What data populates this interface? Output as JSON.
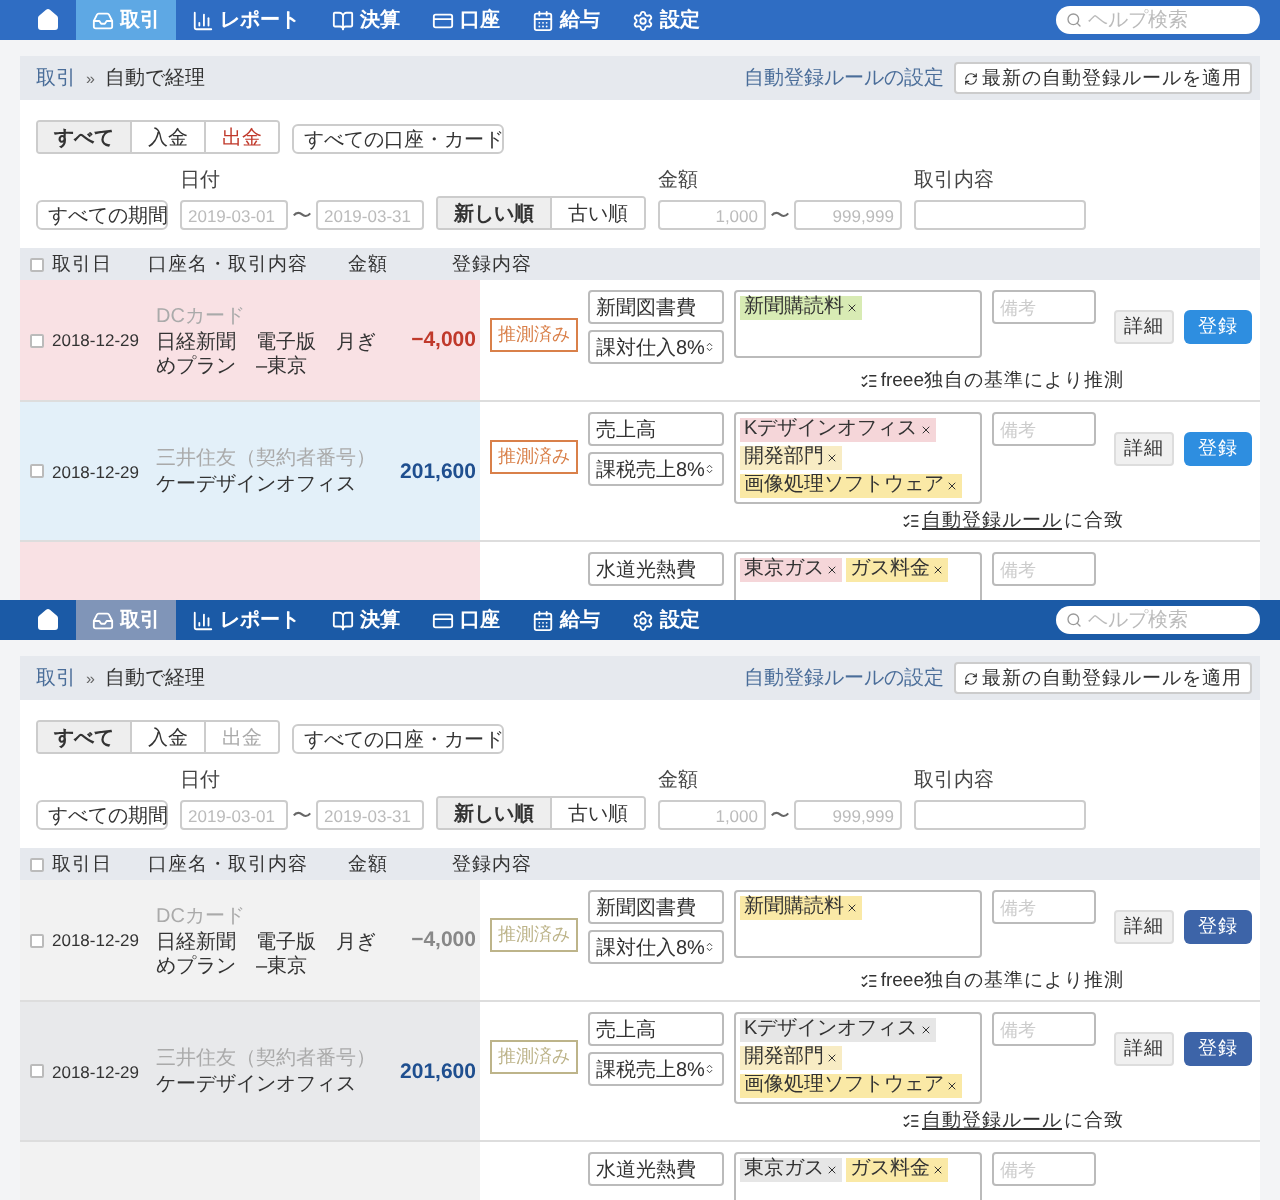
{
  "panels": [
    {
      "kind": "colored",
      "nav": {
        "items": [
          {
            "label": "取引",
            "selected": true
          },
          {
            "label": "レポート",
            "selected": false
          },
          {
            "label": "決算",
            "selected": false
          },
          {
            "label": "口座",
            "selected": false
          },
          {
            "label": "給与",
            "selected": false
          },
          {
            "label": "設定",
            "selected": false
          }
        ],
        "search_placeholder": "ヘルプ検索"
      },
      "breadcrumb": {
        "items": [
          "取引",
          "自動で経理"
        ],
        "separator": "»",
        "rule_link": "自動登録ルールの設定",
        "apply_button": "最新の自動登録ルールを適用"
      },
      "filters": {
        "type_tabs": [
          {
            "label": "すべて",
            "selected": true,
            "kind": "all"
          },
          {
            "label": "入金",
            "selected": false,
            "kind": "in"
          },
          {
            "label": "出金",
            "selected": false,
            "kind": "out"
          }
        ],
        "account_select": "すべての口座・カード",
        "period_select": "すべての期間",
        "date_label": "日付",
        "date_from_placeholder": "2019-03-01",
        "date_to_placeholder": "2019-03-31",
        "range_sep": "〜",
        "sort_tabs": [
          {
            "label": "新しい順",
            "selected": true
          },
          {
            "label": "古い順",
            "selected": false
          }
        ],
        "amount_label": "金額",
        "amount_min_placeholder": "1,000",
        "amount_max_placeholder": "999,999",
        "content_label": "取引内容"
      },
      "table": {
        "header_checked": false,
        "columns": [
          "取引日",
          "口座名・取引内容",
          "金額",
          "登録内容"
        ],
        "rows": [
          {
            "kind": "expense",
            "checked": false,
            "date": "2018-12-29",
            "account": "DCカード",
            "description": "日経新聞　電子版　月ぎめプラン　–東京",
            "amount": "−4,000",
            "status": "推測済み",
            "category": "新聞図書費",
            "tax": "課対仕入8%",
            "tags": [
              {
                "label": "新聞購読料",
                "color": "#d8ebb4"
              }
            ],
            "memo_placeholder": "備考",
            "detail_button": "詳細",
            "register_button": "登録",
            "note": {
              "text": "freee独自の基準により推測"
            }
          },
          {
            "kind": "income",
            "checked": false,
            "date": "2018-12-29",
            "account": "三井住友（契約者番号）",
            "description": "ケーデザインオフィス",
            "amount": "201,600",
            "status": "推測済み",
            "category": "売上高",
            "tax": "課税売上8%",
            "tags": [
              {
                "label": "Kデザインオフィス",
                "color": "#f5d6d9"
              },
              {
                "label": "開発部門",
                "color": "#f8ecc4"
              },
              {
                "label": "画像処理ソフトウェア",
                "color": "#fae9a6"
              }
            ],
            "memo_placeholder": "備考",
            "detail_button": "詳細",
            "register_button": "登録",
            "note": {
              "link": "自動登録ルール",
              "text": "に合致"
            }
          },
          {
            "kind": "expense",
            "category": "水道光熱費",
            "tags": [
              {
                "label": "東京ガス",
                "color": "#f5d6d9"
              },
              {
                "label": "ガス料金",
                "color": "#fae9a6"
              }
            ],
            "memo_placeholder": "備考"
          }
        ]
      }
    },
    {
      "kind": "muted",
      "nav": {
        "items": [
          {
            "label": "取引",
            "selected": true
          },
          {
            "label": "レポート",
            "selected": false
          },
          {
            "label": "決算",
            "selected": false
          },
          {
            "label": "口座",
            "selected": false
          },
          {
            "label": "給与",
            "selected": false
          },
          {
            "label": "設定",
            "selected": false
          }
        ],
        "search_placeholder": "ヘルプ検索"
      },
      "breadcrumb": {
        "items": [
          "取引",
          "自動で経理"
        ],
        "separator": "»",
        "rule_link": "自動登録ルールの設定",
        "apply_button": "最新の自動登録ルールを適用"
      },
      "filters": {
        "type_tabs": [
          {
            "label": "すべて",
            "selected": true,
            "kind": "all"
          },
          {
            "label": "入金",
            "selected": false,
            "kind": "in"
          },
          {
            "label": "出金",
            "selected": false,
            "kind": "out"
          }
        ],
        "account_select": "すべての口座・カード",
        "period_select": "すべての期間",
        "date_label": "日付",
        "date_from_placeholder": "2019-03-01",
        "date_to_placeholder": "2019-03-31",
        "range_sep": "〜",
        "sort_tabs": [
          {
            "label": "新しい順",
            "selected": true
          },
          {
            "label": "古い順",
            "selected": false
          }
        ],
        "amount_label": "金額",
        "amount_min_placeholder": "1,000",
        "amount_max_placeholder": "999,999",
        "content_label": "取引内容"
      },
      "table": {
        "header_checked": false,
        "columns": [
          "取引日",
          "口座名・取引内容",
          "金額",
          "登録内容"
        ],
        "rows": [
          {
            "kind": "expense",
            "checked": false,
            "date": "2018-12-29",
            "account": "DCカード",
            "description": "日経新聞　電子版　月ぎめプラン　–東京",
            "amount": "−4,000",
            "status": "推測済み",
            "category": "新聞図書費",
            "tax": "課対仕入8%",
            "tags": [
              {
                "label": "新聞購読料",
                "color": "#fae9a6"
              }
            ],
            "memo_placeholder": "備考",
            "detail_button": "詳細",
            "register_button": "登録",
            "note": {
              "text": "freee独自の基準により推測"
            }
          },
          {
            "kind": "income",
            "checked": false,
            "date": "2018-12-29",
            "account": "三井住友（契約者番号）",
            "description": "ケーデザインオフィス",
            "amount": "201,600",
            "status": "推測済み",
            "category": "売上高",
            "tax": "課税売上8%",
            "tags": [
              {
                "label": "Kデザインオフィス",
                "color": "#e6e6e6"
              },
              {
                "label": "開発部門",
                "color": "#f8ecc4"
              },
              {
                "label": "画像処理ソフトウェア",
                "color": "#fae9a6"
              }
            ],
            "memo_placeholder": "備考",
            "detail_button": "詳細",
            "register_button": "登録",
            "note": {
              "link": "自動登録ルール",
              "text": "に合致"
            }
          },
          {
            "kind": "expense",
            "category": "水道光熱費",
            "tags": [
              {
                "label": "東京ガス",
                "color": "#e6e6e6"
              },
              {
                "label": "ガス料金",
                "color": "#fae9a6"
              }
            ],
            "memo_placeholder": "備考"
          }
        ]
      }
    }
  ]
}
